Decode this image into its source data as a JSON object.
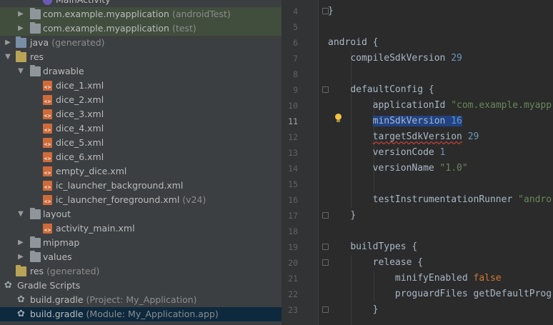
{
  "project_tree": {
    "items": [
      {
        "label": "MainActivity",
        "sub": ""
      },
      {
        "label": "com.example.myapplication",
        "sub": "(androidTest)"
      },
      {
        "label": "com.example.myapplication",
        "sub": "(test)"
      },
      {
        "label": "java",
        "sub": "(generated)"
      },
      {
        "label": "res",
        "sub": ""
      },
      {
        "label": "drawable",
        "sub": ""
      },
      {
        "label": "dice_1.xml",
        "sub": ""
      },
      {
        "label": "dice_2.xml",
        "sub": ""
      },
      {
        "label": "dice_3.xml",
        "sub": ""
      },
      {
        "label": "dice_4.xml",
        "sub": ""
      },
      {
        "label": "dice_5.xml",
        "sub": ""
      },
      {
        "label": "dice_6.xml",
        "sub": ""
      },
      {
        "label": "empty_dice.xml",
        "sub": ""
      },
      {
        "label": "ic_launcher_background.xml",
        "sub": ""
      },
      {
        "label": "ic_launcher_foreground.xml",
        "sub": "(v24)"
      },
      {
        "label": "layout",
        "sub": ""
      },
      {
        "label": "activity_main.xml",
        "sub": ""
      },
      {
        "label": "mipmap",
        "sub": ""
      },
      {
        "label": "values",
        "sub": ""
      },
      {
        "label": "res",
        "sub": "(generated)"
      },
      {
        "label": "Gradle Scripts",
        "sub": ""
      },
      {
        "label": "build.gradle",
        "sub": "(Project: My_Application)"
      },
      {
        "label": "build.gradle",
        "sub": "(Module: My_Application.app)"
      }
    ]
  },
  "editor": {
    "line_numbers": [
      "4",
      "5",
      "6",
      "7",
      "8",
      "9",
      "10",
      "11",
      "12",
      "13",
      "14",
      "15",
      "16",
      "17",
      "18",
      "19",
      "20",
      "21",
      "22",
      "23"
    ],
    "current_line": "11",
    "lines": {
      "l4": "}",
      "l6": "android {",
      "l7a": "compileSdkVersion",
      "l7b": "29",
      "l9": "defaultConfig {",
      "l10a": "applicationId",
      "l10b": "\"com.example.myapp",
      "l11a": "minSdkVersion",
      "l11b": "16",
      "l12a": "targetSdkVersion",
      "l12b": "29",
      "l13a": "versionCode",
      "l13b": "1",
      "l14a": "versionName",
      "l14b": "\"1.0\"",
      "l16a": "testInstrumentationRunner",
      "l16b": "\"andro",
      "l17": "}",
      "l19": "buildTypes {",
      "l20": "release {",
      "l21a": "minifyEnabled",
      "l21b": "false",
      "l22a": "proguardFiles",
      "l22b": "getDefaultProg",
      "l23": "}"
    }
  },
  "colors": {
    "editor_bg": "#2b2b2b",
    "panel_bg": "#3c3f41",
    "selection": "#214283",
    "keyword": "#cc7832",
    "number": "#6897bb",
    "string": "#6a8759"
  },
  "icons": [
    "chevron-right-icon",
    "chevron-down-icon",
    "folder-icon",
    "xml-file-icon",
    "gradle-icon",
    "kotlin-class-icon",
    "bulb-icon"
  ]
}
